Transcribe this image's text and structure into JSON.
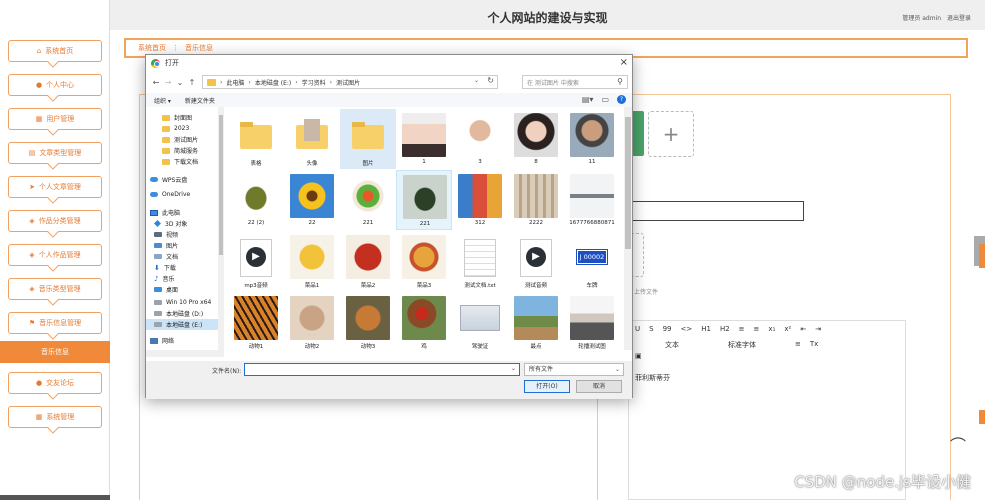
{
  "header": {
    "title": "个人网站的建设与实现",
    "user_label": "管理员 admin",
    "logout_label": "退出登录"
  },
  "breadcrumb": {
    "home": "系统首页",
    "current": "音乐信息"
  },
  "sidebar": {
    "items": [
      {
        "label": "系统首页",
        "icon": "home-icon"
      },
      {
        "label": "个人中心",
        "icon": "user-icon"
      },
      {
        "label": "用户管理",
        "icon": "grid-icon"
      },
      {
        "label": "文章类型管理",
        "icon": "file-icon"
      },
      {
        "label": "个人文章管理",
        "icon": "send-icon"
      },
      {
        "label": "作品分类管理",
        "icon": "layers-icon"
      },
      {
        "label": "个人作品管理",
        "icon": "layers-icon"
      },
      {
        "label": "音乐类型管理",
        "icon": "layers-icon"
      },
      {
        "label": "音乐信息管理",
        "icon": "flag-icon"
      },
      {
        "label": "音乐信息",
        "icon": "",
        "active": true
      },
      {
        "label": "交友论坛",
        "icon": "users-icon"
      },
      {
        "label": "系统管理",
        "icon": "grid-icon"
      }
    ]
  },
  "form": {
    "partial_text": "c",
    "upload_file_text": "上传文件",
    "editor_text": "菲利斯蒂芬",
    "toolbar_row1": [
      "U",
      "S",
      "99",
      "<>",
      "H1",
      "H2",
      "≡",
      "≡",
      "x₁",
      "x²",
      "⇤",
      "⇥"
    ],
    "toolbar_row2": [
      "文本",
      "标准字体",
      "≡",
      "Tx"
    ]
  },
  "dialog": {
    "title": "打开",
    "close": "×",
    "path": [
      "此电脑",
      "本地磁盘 (E:)",
      "学习资料",
      "测试图片"
    ],
    "search_placeholder": "在 测试图片 中搜索",
    "organize_label": "组织 ▾",
    "new_folder_label": "新建文件夹",
    "nav_items": [
      {
        "label": "封面图",
        "icon": "folder-icon"
      },
      {
        "label": "2023",
        "icon": "folder-icon"
      },
      {
        "label": "测试图片",
        "icon": "folder-icon"
      },
      {
        "label": "简城服务",
        "icon": "folder-icon"
      },
      {
        "label": "下载文档",
        "icon": "folder-icon"
      },
      {
        "label": "WPS云盘",
        "icon": "cloud-icon"
      },
      {
        "label": "OneDrive",
        "icon": "cloud-icon"
      },
      {
        "label": "此电脑",
        "icon": "pc-icon"
      },
      {
        "label": "3D 对象",
        "icon": "cube-icon"
      },
      {
        "label": "视频",
        "icon": "video-icon"
      },
      {
        "label": "图片",
        "icon": "picture-icon"
      },
      {
        "label": "文档",
        "icon": "doc-icon"
      },
      {
        "label": "下载",
        "icon": "download-icon"
      },
      {
        "label": "音乐",
        "icon": "music-icon"
      },
      {
        "label": "桌面",
        "icon": "desktop-icon"
      },
      {
        "label": "Win 10 Pro x64",
        "icon": "drive-icon"
      },
      {
        "label": "本地磁盘 (D:)",
        "icon": "drive-icon"
      },
      {
        "label": "本地磁盘 (E:)",
        "icon": "drive-icon",
        "selected": true
      },
      {
        "label": "网络",
        "icon": "network-icon"
      }
    ],
    "files": [
      {
        "label": "表格",
        "kind": "folder"
      },
      {
        "label": "头像",
        "kind": "folder-photo"
      },
      {
        "label": "图片",
        "kind": "folder",
        "highlight": true
      },
      {
        "label": "1",
        "kind": "portrait-woman"
      },
      {
        "label": "3",
        "kind": "portrait-man"
      },
      {
        "label": "8",
        "kind": "portrait-woman2"
      },
      {
        "label": "11",
        "kind": "portrait-man2"
      },
      {
        "label": "22 (2)",
        "kind": "beetle"
      },
      {
        "label": "22",
        "kind": "sunflower"
      },
      {
        "label": "221",
        "kind": "food-salad"
      },
      {
        "label": "221",
        "kind": "beetle2",
        "hover": true
      },
      {
        "label": "312",
        "kind": "archive"
      },
      {
        "label": "2222",
        "kind": "bottles"
      },
      {
        "label": "1677766880871",
        "kind": "plane"
      },
      {
        "label": "mp3音频",
        "kind": "media"
      },
      {
        "label": "菜品1",
        "kind": "food-egg"
      },
      {
        "label": "菜品2",
        "kind": "food-crayfish"
      },
      {
        "label": "菜品3",
        "kind": "food-fries"
      },
      {
        "label": "测试文档.txt",
        "kind": "txt"
      },
      {
        "label": "测试音频",
        "kind": "media"
      },
      {
        "label": "车牌",
        "kind": "plate"
      },
      {
        "label": "动物1",
        "kind": "tiger"
      },
      {
        "label": "动物2",
        "kind": "rabbit"
      },
      {
        "label": "动物3",
        "kind": "fox"
      },
      {
        "label": "鸡",
        "kind": "rooster"
      },
      {
        "label": "驾驶证",
        "kind": "license"
      },
      {
        "label": "最点",
        "kind": "landscape"
      },
      {
        "label": "轮播测试图",
        "kind": "meeting"
      }
    ],
    "plate_text": "J 00002",
    "filename_label": "文件名(N):",
    "filename_value": "",
    "filetype_value": "所有文件",
    "open_label": "打开(O)",
    "cancel_label": "取消"
  },
  "watermark": "CSDN @node.js毕设小健",
  "colors": {
    "accent": "#f08a3a",
    "sidebar_border": "#f0a060",
    "selection": "#cce4f7"
  }
}
